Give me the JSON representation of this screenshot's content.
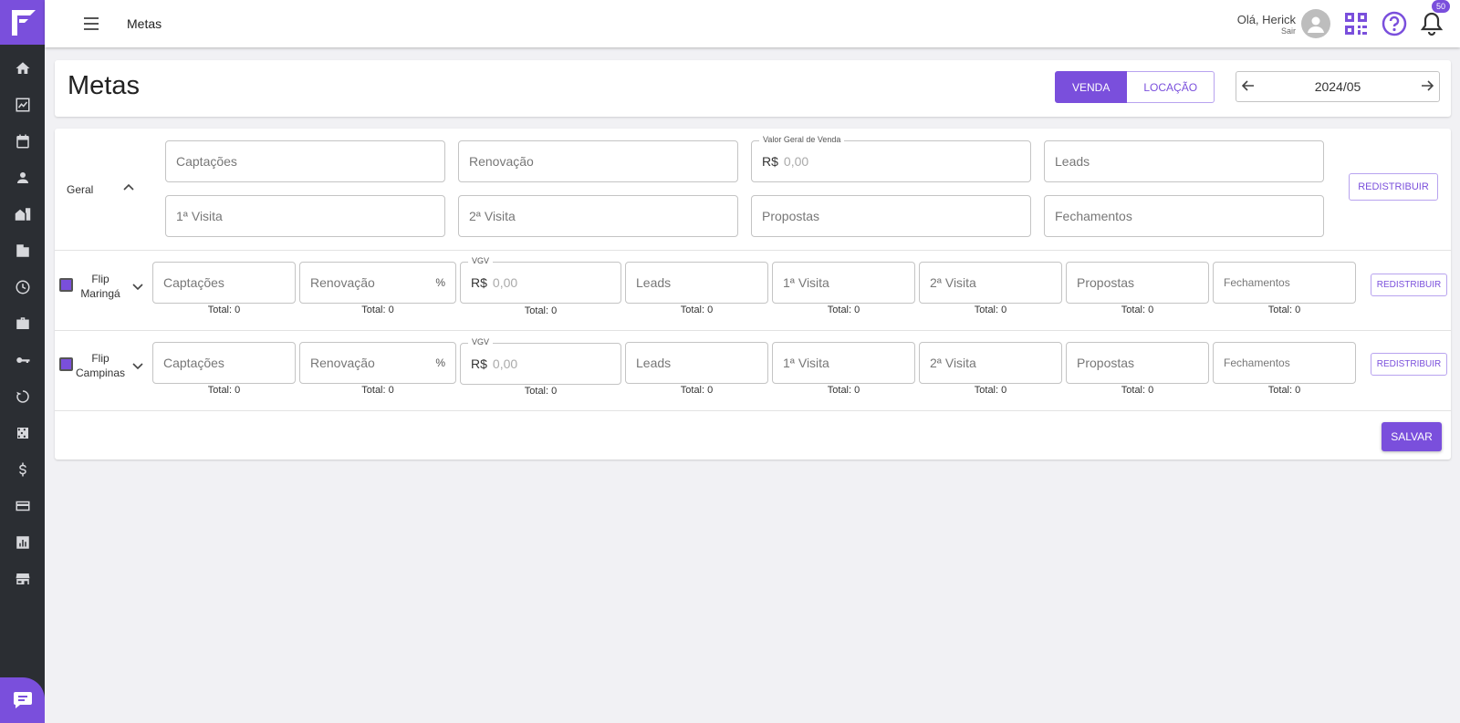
{
  "topbar": {
    "title": "Metas",
    "greeting": "Olá, Herick",
    "logout": "Sair",
    "notifications": "50"
  },
  "header": {
    "title": "Metas",
    "tab_venda": "VENDA",
    "tab_locacao": "LOCAÇÃO",
    "period": "2024/05"
  },
  "geral": {
    "label": "Geral",
    "fields": {
      "captacoes": "Captações",
      "renovacao": "Renovação",
      "vgv_label": "Valor Geral de Venda",
      "currency": "R$",
      "vgv_placeholder": "0,00",
      "leads": "Leads",
      "visita1": "1ª Visita",
      "visita2": "2ª Visita",
      "propostas": "Propostas",
      "fechamentos": "Fechamentos"
    },
    "redistribute": "REDISTRIBUIR"
  },
  "units": [
    {
      "name": "Flip Maringá",
      "captacoes": "Captações",
      "renovacao": "Renovação",
      "percent": "%",
      "vgv_label": "VGV",
      "currency": "R$",
      "vgv_placeholder": "0,00",
      "leads": "Leads",
      "visita1": "1ª Visita",
      "visita2": "2ª Visita",
      "propostas": "Propostas",
      "fechamentos": "Fechamentos",
      "totals": [
        "Total: 0",
        "Total: 0",
        "Total: 0",
        "Total: 0",
        "Total: 0",
        "Total: 0",
        "Total: 0",
        "Total: 0"
      ],
      "redistribute": "REDISTRIBUIR"
    },
    {
      "name": "Flip Campinas",
      "captacoes": "Captações",
      "renovacao": "Renovação",
      "percent": "%",
      "vgv_label": "VGV",
      "currency": "R$",
      "vgv_placeholder": "0,00",
      "leads": "Leads",
      "visita1": "1ª Visita",
      "visita2": "2ª Visita",
      "propostas": "Propostas",
      "fechamentos": "Fechamentos",
      "totals": [
        "Total: 0",
        "Total: 0",
        "Total: 0",
        "Total: 0",
        "Total: 0",
        "Total: 0",
        "Total: 0",
        "Total: 0"
      ],
      "redistribute": "REDISTRIBUIR"
    }
  ],
  "save": "SALVAR",
  "colors": {
    "accent": "#7a4fdc",
    "sidebar": "#2b2e33"
  },
  "sidebar_icons": [
    "home-icon",
    "chart-line-icon",
    "calendar-icon",
    "person-icon",
    "house-building-icon",
    "building-icon",
    "clock-icon",
    "briefcase-icon",
    "key-icon",
    "history-icon",
    "dice-icon",
    "dollar-icon",
    "credit-card-icon",
    "report-icon",
    "store-icon"
  ]
}
